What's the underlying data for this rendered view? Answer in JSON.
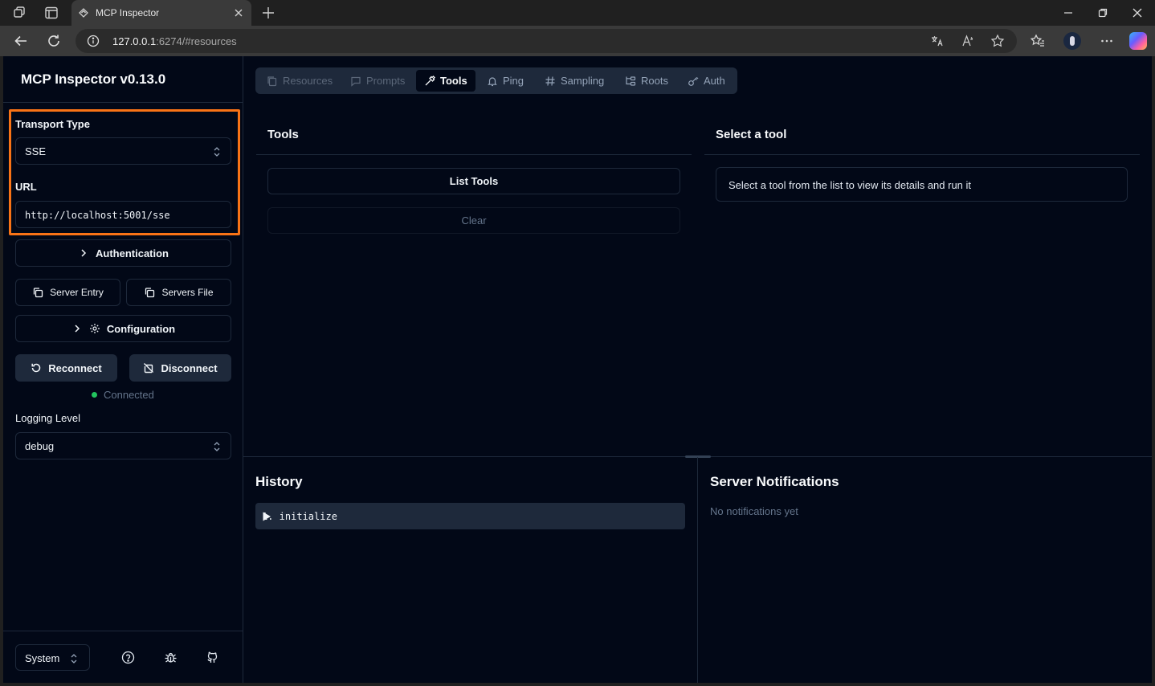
{
  "browser": {
    "tab_title": "MCP Inspector",
    "url_host": "127.0.0.1",
    "url_path": ":6274/#resources"
  },
  "sidebar": {
    "app_title": "MCP Inspector v0.13.0",
    "transport_label": "Transport Type",
    "transport_value": "SSE",
    "url_label": "URL",
    "url_value": "http://localhost:5001/sse",
    "authentication_label": "Authentication",
    "server_entry_label": "Server Entry",
    "servers_file_label": "Servers File",
    "configuration_label": "Configuration",
    "reconnect_label": "Reconnect",
    "disconnect_label": "Disconnect",
    "status_text": "Connected",
    "logging_label": "Logging Level",
    "logging_value": "debug",
    "theme_value": "System"
  },
  "tabs": [
    {
      "label": "Resources",
      "icon": "file-icon",
      "state": "disabled"
    },
    {
      "label": "Prompts",
      "icon": "message-icon",
      "state": "disabled"
    },
    {
      "label": "Tools",
      "icon": "hammer-icon",
      "state": "active"
    },
    {
      "label": "Ping",
      "icon": "bell-icon",
      "state": "normal"
    },
    {
      "label": "Sampling",
      "icon": "hash-icon",
      "state": "normal"
    },
    {
      "label": "Roots",
      "icon": "folder-tree-icon",
      "state": "normal"
    },
    {
      "label": "Auth",
      "icon": "key-icon",
      "state": "normal"
    }
  ],
  "tools_panel": {
    "title": "Tools",
    "list_button": "List Tools",
    "clear_button": "Clear"
  },
  "tool_detail": {
    "title": "Select a tool",
    "hint": "Select a tool from the list to view its details and run it"
  },
  "history": {
    "title": "History",
    "items": [
      "1. initialize"
    ]
  },
  "notifications": {
    "title": "Server Notifications",
    "empty": "No notifications yet"
  },
  "colors": {
    "app_bg": "#020817",
    "border": "#1e293b",
    "highlight": "#f97316",
    "status_ok": "#22c55e"
  }
}
